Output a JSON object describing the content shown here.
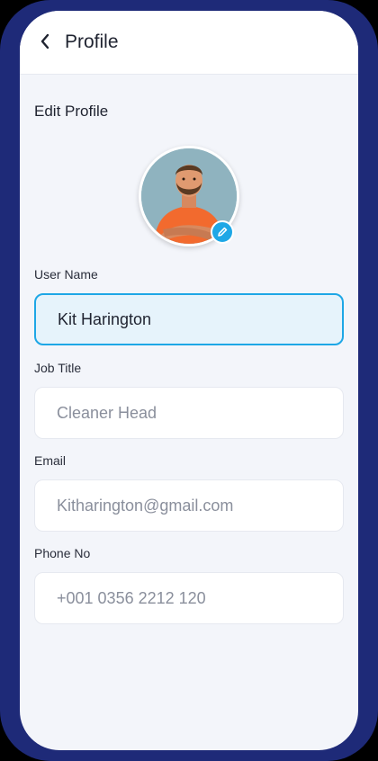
{
  "header": {
    "title": "Profile",
    "back_icon": "chevron-left-icon"
  },
  "section": {
    "title": "Edit Profile"
  },
  "avatar": {
    "edit_icon": "pencil-icon"
  },
  "form": {
    "username": {
      "label": "User Name",
      "value": "Kit Harington"
    },
    "job_title": {
      "label": "Job Title",
      "placeholder": "Cleaner Head"
    },
    "email": {
      "label": "Email",
      "placeholder": "Kitharington@gmail.com"
    },
    "phone": {
      "label": "Phone No",
      "placeholder": "+001 0356 2212 120"
    }
  },
  "colors": {
    "frame": "#1e2a78",
    "accent": "#1ea7e6",
    "screen_bg": "#f3f5fa",
    "active_field_bg": "#e6f3fb"
  }
}
